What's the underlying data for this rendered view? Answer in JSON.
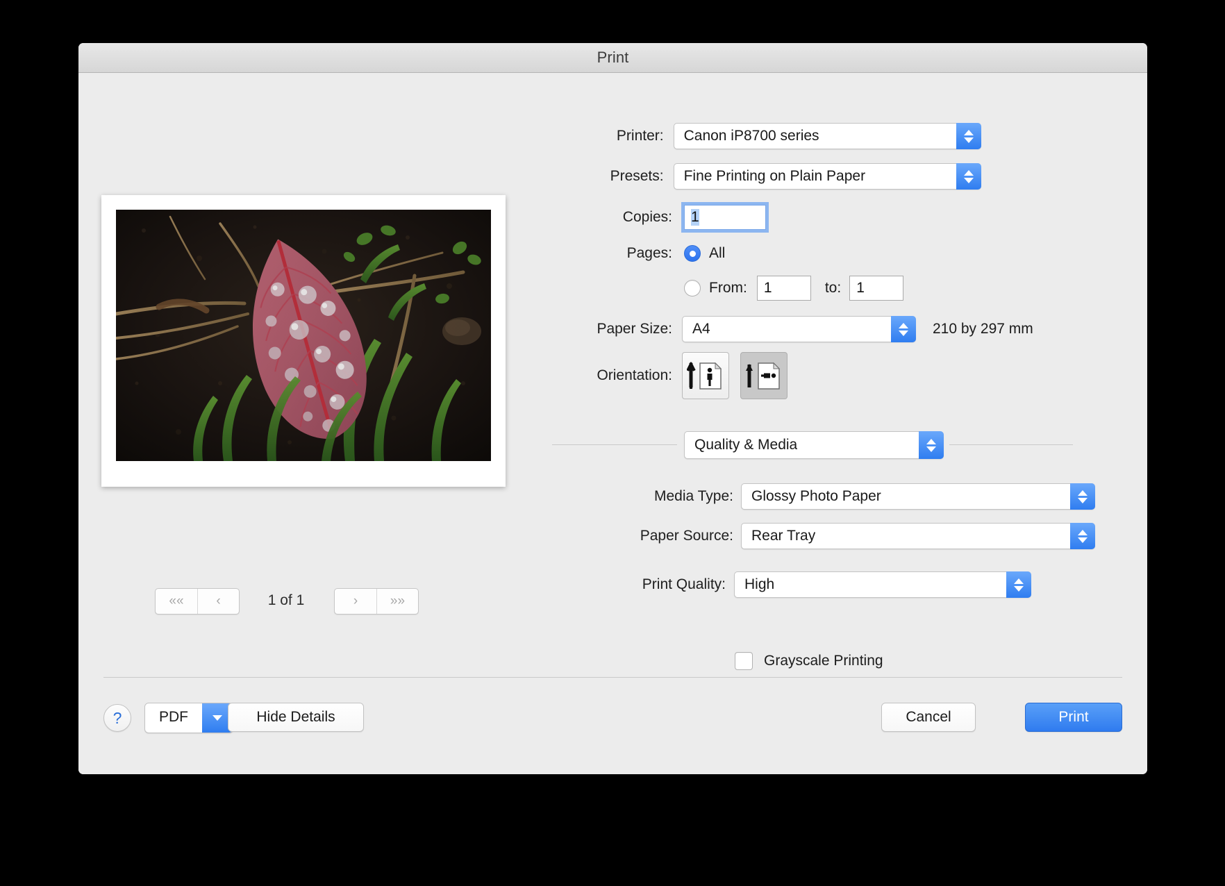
{
  "window": {
    "title": "Print"
  },
  "preview": {
    "photo_alt": "red-leaf-with-water-droplets-on-soil",
    "nav": {
      "first_label": "««",
      "prev_label": "‹",
      "next_label": "›",
      "last_label": "»»",
      "page_indicator": "1 of 1"
    }
  },
  "settings": {
    "printer": {
      "label": "Printer:",
      "value": "Canon iP8700 series"
    },
    "presets": {
      "label": "Presets:",
      "value": "Fine Printing on Plain Paper"
    },
    "copies": {
      "label": "Copies:",
      "value": "1"
    },
    "pages": {
      "label": "Pages:",
      "all_label": "All",
      "all_selected": true,
      "range_selected": false,
      "from_label": "From:",
      "from_value": "1",
      "to_label": "to:",
      "to_value": "1"
    },
    "paper_size": {
      "label": "Paper Size:",
      "value": "A4",
      "dimensions": "210 by 297 mm"
    },
    "orientation": {
      "label": "Orientation:",
      "portrait_name": "portrait",
      "landscape_name": "landscape",
      "selected": "landscape"
    },
    "pane_popup": {
      "value": "Quality & Media"
    },
    "media_type": {
      "label": "Media Type:",
      "value": "Glossy Photo Paper"
    },
    "paper_source": {
      "label": "Paper Source:",
      "value": "Rear Tray"
    },
    "print_quality": {
      "label": "Print Quality:",
      "value": "High"
    },
    "grayscale": {
      "label": "Grayscale Printing",
      "checked": false
    }
  },
  "footer": {
    "help_label": "?",
    "pdf_label": "PDF",
    "hide_details_label": "Hide Details",
    "cancel_label": "Cancel",
    "print_label": "Print"
  },
  "colors": {
    "accent_blue": "#2f7df0",
    "window_bg": "#ececec",
    "titlebar_bg": "#dedede"
  }
}
